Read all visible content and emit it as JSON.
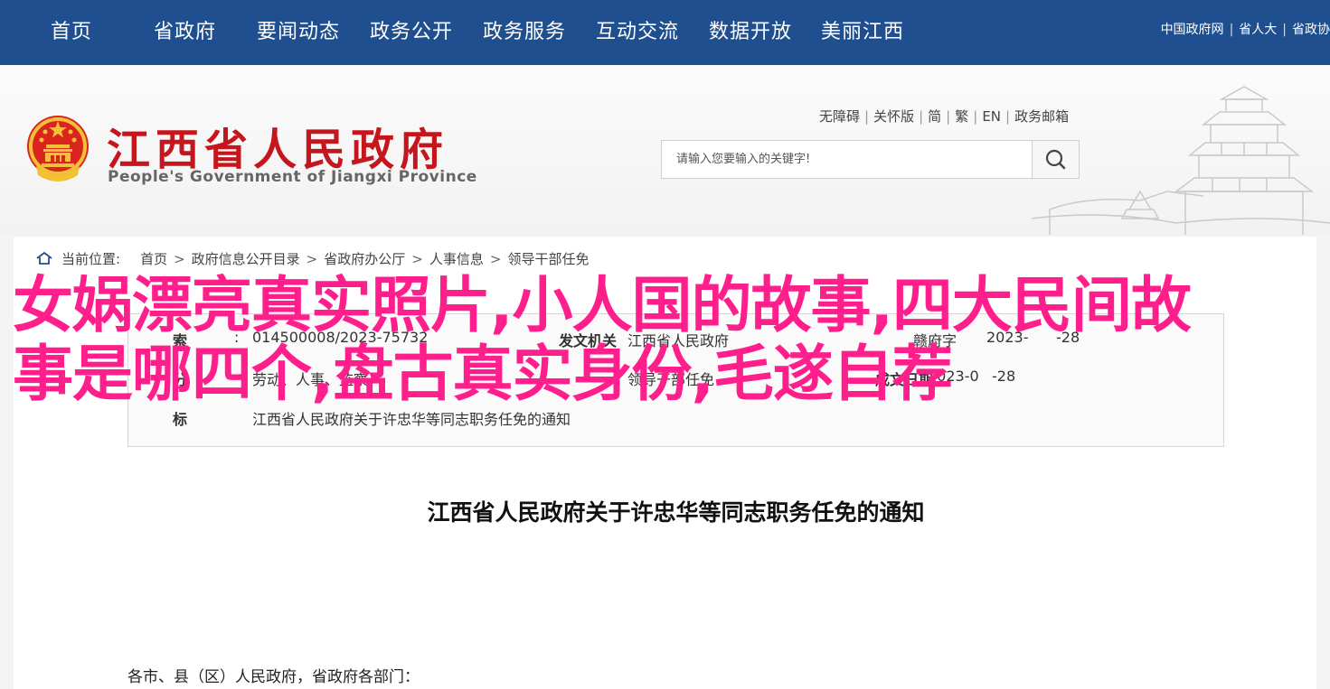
{
  "topnav": {
    "items": [
      "首页",
      "省政府",
      "要闻动态",
      "政务公开",
      "政务服务",
      "互动交流",
      "数据开放",
      "美丽江西"
    ],
    "links": [
      "中国政府网",
      "省人大",
      "省政协"
    ]
  },
  "header": {
    "title": "江西省人民政府",
    "subtitle": "People's Government of Jiangxi Province",
    "access_links": [
      "无障碍",
      "关怀版",
      "简",
      "繁",
      "EN",
      "政务邮箱"
    ],
    "search_placeholder": "请输入您要输入的关键字!"
  },
  "breadcrumb": {
    "label": "当前位置:",
    "items": [
      "首页",
      "政府信息公开目录",
      "省政府办公厅",
      "人事信息",
      "领导干部任免"
    ]
  },
  "info": {
    "row1_index": "014500008/2023-75732",
    "row1_org_key": "发文机关",
    "row1_org": "江西省人民政府",
    "row1_date_fragment": "2023-",
    "row1_date_tail": "-28",
    "row2_category": "劳动、人事、监察",
    "row2_subject": "领导干部任免",
    "row2_date_key": "成文日期",
    "row2_date": "2023-0",
    "row2_date_tail": "-28",
    "row3_title": "江西省人民政府关于许忠华等同志职务任免的通知",
    "row1_tail_fragment": "赣府字",
    "keys": [
      "索",
      "分",
      "标"
    ],
    "key_suffix": ":"
  },
  "overlay_text": "女娲漂亮真实照片,小人国的故事,四大民间故事是哪四个,盘古真实身份,毛遂自荐",
  "document": {
    "title": "江西省人民政府关于许忠华等同志职务任免的通知",
    "salutation": "各市、县（区）人民政府，省政府各部门："
  },
  "colors": {
    "nav_bg": "#1f4f8e",
    "brand_red": "#c4161c",
    "overlay_pink": "#ff1f8c"
  }
}
